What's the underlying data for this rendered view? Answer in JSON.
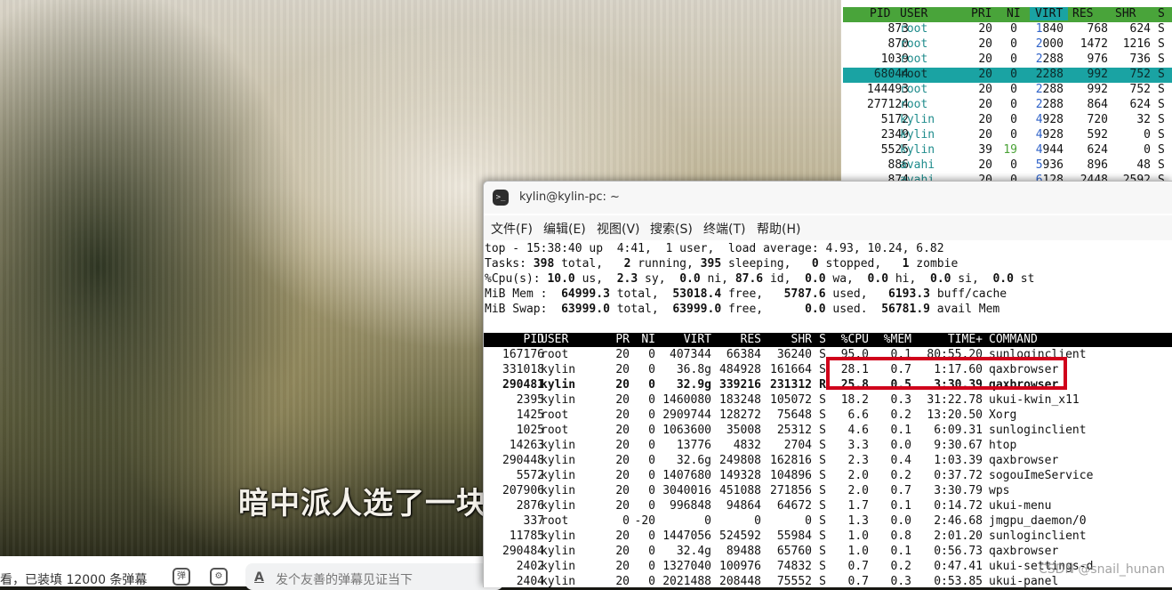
{
  "video": {
    "subtitle": "暗中派人选了一块",
    "danmaku_count": "看，已装填 12000 条弹幕",
    "danmaku_placeholder": "发个友善的弹幕见证当下",
    "icons": [
      "danmaku-toggle-icon",
      "danmaku-settings-icon",
      "text-style-icon"
    ]
  },
  "htop_bg": {
    "columns": [
      "PID",
      "USER",
      "PRI",
      "NI",
      "VIRT",
      "RES",
      "SHR",
      "S"
    ],
    "rows": [
      {
        "pid": "873",
        "user": "root",
        "pri": "20",
        "ni": "0",
        "virt": "1840",
        "res": "768",
        "shr": "624",
        "s": "S"
      },
      {
        "pid": "870",
        "user": "root",
        "pri": "20",
        "ni": "0",
        "virt": "2000",
        "res": "1472",
        "shr": "1216",
        "s": "S"
      },
      {
        "pid": "1039",
        "user": "root",
        "pri": "20",
        "ni": "0",
        "virt": "2288",
        "res": "976",
        "shr": "736",
        "s": "S"
      },
      {
        "pid": "68044",
        "user": "root",
        "pri": "20",
        "ni": "0",
        "virt": "2288",
        "res": "992",
        "shr": "752",
        "s": "S"
      },
      {
        "pid": "144493",
        "user": "root",
        "pri": "20",
        "ni": "0",
        "virt": "2288",
        "res": "992",
        "shr": "752",
        "s": "S"
      },
      {
        "pid": "277124",
        "user": "root",
        "pri": "20",
        "ni": "0",
        "virt": "2288",
        "res": "864",
        "shr": "624",
        "s": "S"
      },
      {
        "pid": "5172",
        "user": "kylin",
        "pri": "20",
        "ni": "0",
        "virt": "4928",
        "res": "720",
        "shr": "32",
        "s": "S"
      },
      {
        "pid": "2349",
        "user": "kylin",
        "pri": "20",
        "ni": "0",
        "virt": "4928",
        "res": "592",
        "shr": "0",
        "s": "S"
      },
      {
        "pid": "5525",
        "user": "kylin",
        "pri": "39",
        "ni": "19",
        "virt": "4944",
        "res": "624",
        "shr": "0",
        "s": "S"
      },
      {
        "pid": "886",
        "user": "avahi",
        "pri": "20",
        "ni": "0",
        "virt": "5936",
        "res": "896",
        "shr": "48",
        "s": "S"
      },
      {
        "pid": "874",
        "user": "avahi",
        "pri": "20",
        "ni": "0",
        "virt": "6128",
        "res": "2448",
        "shr": "2592",
        "s": "S"
      }
    ]
  },
  "terminal": {
    "title": "kylin@kylin-pc: ~",
    "menu": [
      "文件(F)",
      "编辑(E)",
      "视图(V)",
      "搜索(S)",
      "终端(T)",
      "帮助(H)"
    ],
    "summary": {
      "line1": "top - 15:38:40 up  4:41,  1 user,  load average: 4.93, 10.24, 6.82",
      "tasks": {
        "label": "Tasks:",
        "total": "398",
        "running": "2",
        "sleeping": "395",
        "stopped": "0",
        "zombie": "1"
      },
      "cpu": {
        "label": "%Cpu(s):",
        "us": "10.0",
        "sy": "2.3",
        "ni": "0.0",
        "id": "87.6",
        "wa": "0.0",
        "hi": "0.0",
        "si": "0.0",
        "st": "0.0"
      },
      "mem": {
        "label": "MiB Mem :",
        "total": "64999.3",
        "free": "53018.4",
        "used": "5787.6",
        "buff": "6193.3"
      },
      "swap": {
        "label": "MiB Swap:",
        "total": "63999.0",
        "free": "63999.0",
        "used": "0.0",
        "avail": "56781.9"
      }
    },
    "columns": [
      "PID",
      "USER",
      "PR",
      "NI",
      "VIRT",
      "RES",
      "SHR",
      "S",
      "%CPU",
      "%MEM",
      "TIME+",
      "COMMAND"
    ],
    "processes": [
      {
        "pid": "167176",
        "user": "root",
        "pr": "20",
        "ni": "0",
        "virt": "407344",
        "res": "66384",
        "shr": "36240",
        "s": "S",
        "cpu": "95.0",
        "mem": "0.1",
        "time": "80:55.20",
        "cmd": "sunloginclient"
      },
      {
        "pid": "331018",
        "user": "kylin",
        "pr": "20",
        "ni": "0",
        "virt": "36.8g",
        "res": "484928",
        "shr": "161664",
        "s": "S",
        "cpu": "28.1",
        "mem": "0.7",
        "time": "1:17.60",
        "cmd": "qaxbrowser"
      },
      {
        "pid": "290481",
        "user": "kylin",
        "pr": "20",
        "ni": "0",
        "virt": "32.9g",
        "res": "339216",
        "shr": "231312",
        "s": "R",
        "cpu": "25.8",
        "mem": "0.5",
        "time": "3:30.39",
        "cmd": "qaxbrowser"
      },
      {
        "pid": "2395",
        "user": "kylin",
        "pr": "20",
        "ni": "0",
        "virt": "1460080",
        "res": "183248",
        "shr": "105072",
        "s": "S",
        "cpu": "18.2",
        "mem": "0.3",
        "time": "31:22.78",
        "cmd": "ukui-kwin_x11"
      },
      {
        "pid": "1425",
        "user": "root",
        "pr": "20",
        "ni": "0",
        "virt": "2909744",
        "res": "128272",
        "shr": "75648",
        "s": "S",
        "cpu": "6.6",
        "mem": "0.2",
        "time": "13:20.50",
        "cmd": "Xorg"
      },
      {
        "pid": "1025",
        "user": "root",
        "pr": "20",
        "ni": "0",
        "virt": "1063600",
        "res": "35008",
        "shr": "25312",
        "s": "S",
        "cpu": "4.6",
        "mem": "0.1",
        "time": "6:09.31",
        "cmd": "sunloginclient"
      },
      {
        "pid": "14263",
        "user": "kylin",
        "pr": "20",
        "ni": "0",
        "virt": "13776",
        "res": "4832",
        "shr": "2704",
        "s": "S",
        "cpu": "3.3",
        "mem": "0.0",
        "time": "9:30.67",
        "cmd": "htop"
      },
      {
        "pid": "290448",
        "user": "kylin",
        "pr": "20",
        "ni": "0",
        "virt": "32.6g",
        "res": "249808",
        "shr": "162816",
        "s": "S",
        "cpu": "2.3",
        "mem": "0.4",
        "time": "1:03.39",
        "cmd": "qaxbrowser"
      },
      {
        "pid": "5572",
        "user": "kylin",
        "pr": "20",
        "ni": "0",
        "virt": "1407680",
        "res": "149328",
        "shr": "104896",
        "s": "S",
        "cpu": "2.0",
        "mem": "0.2",
        "time": "0:37.72",
        "cmd": "sogouImeService"
      },
      {
        "pid": "207906",
        "user": "kylin",
        "pr": "20",
        "ni": "0",
        "virt": "3040016",
        "res": "451088",
        "shr": "271856",
        "s": "S",
        "cpu": "2.0",
        "mem": "0.7",
        "time": "3:30.79",
        "cmd": "wps"
      },
      {
        "pid": "2876",
        "user": "kylin",
        "pr": "20",
        "ni": "0",
        "virt": "996848",
        "res": "94864",
        "shr": "64672",
        "s": "S",
        "cpu": "1.7",
        "mem": "0.1",
        "time": "0:14.72",
        "cmd": "ukui-menu"
      },
      {
        "pid": "337",
        "user": "root",
        "pr": "0",
        "ni": "-20",
        "virt": "0",
        "res": "0",
        "shr": "0",
        "s": "S",
        "cpu": "1.3",
        "mem": "0.0",
        "time": "2:46.68",
        "cmd": "jmgpu_daemon/0"
      },
      {
        "pid": "11785",
        "user": "kylin",
        "pr": "20",
        "ni": "0",
        "virt": "1447056",
        "res": "524592",
        "shr": "55984",
        "s": "S",
        "cpu": "1.0",
        "mem": "0.8",
        "time": "2:01.20",
        "cmd": "sunloginclient"
      },
      {
        "pid": "290484",
        "user": "kylin",
        "pr": "20",
        "ni": "0",
        "virt": "32.4g",
        "res": "89488",
        "shr": "65760",
        "s": "S",
        "cpu": "1.0",
        "mem": "0.1",
        "time": "0:56.73",
        "cmd": "qaxbrowser"
      },
      {
        "pid": "2402",
        "user": "kylin",
        "pr": "20",
        "ni": "0",
        "virt": "1327040",
        "res": "100976",
        "shr": "74832",
        "s": "S",
        "cpu": "0.7",
        "mem": "0.2",
        "time": "0:47.41",
        "cmd": "ukui-settings-d"
      },
      {
        "pid": "2404",
        "user": "kylin",
        "pr": "20",
        "ni": "0",
        "virt": "2021488",
        "res": "208448",
        "shr": "75552",
        "s": "S",
        "cpu": "0.7",
        "mem": "0.3",
        "time": "0:53.85",
        "cmd": "ukui-panel"
      }
    ]
  },
  "watermark": "CSDN @snail_hunan",
  "colors": {
    "htop_header": "#49a43a",
    "htop_selected": "#1aa3a3",
    "highlight_box": "#d0021b",
    "top_header": "#000000"
  }
}
